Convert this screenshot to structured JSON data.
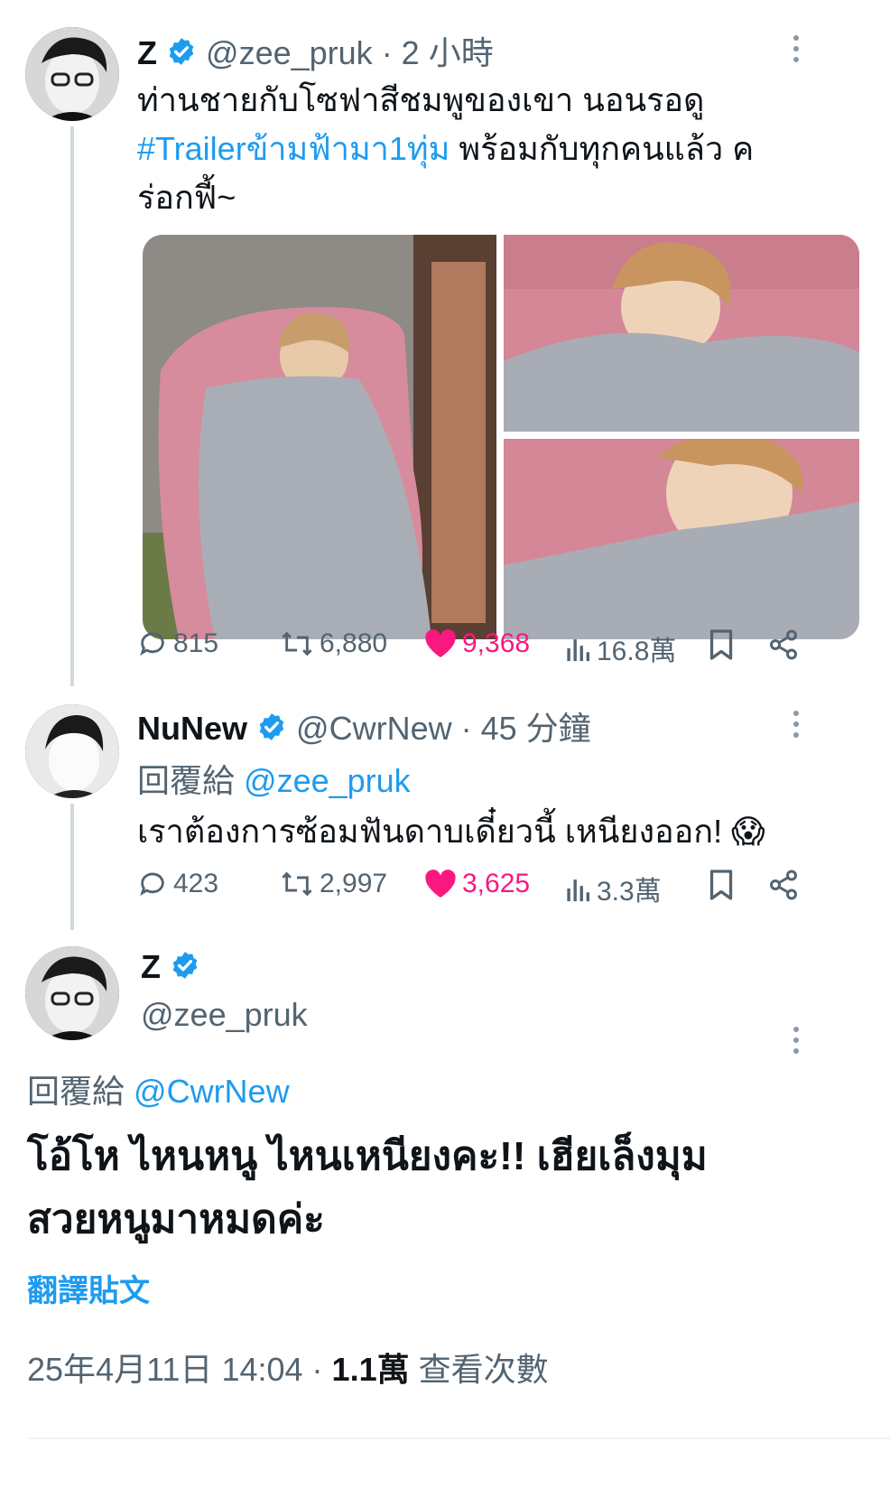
{
  "colors": {
    "accent": "#1d9bf0",
    "like": "#f91880",
    "muted": "#536471",
    "line": "#cfd9de",
    "sofa": "#d88f9f",
    "blanket": "#a8adb5"
  },
  "tweet1": {
    "name": "Z",
    "handle": "@zee_pruk",
    "time": "· 2 小時",
    "text_line1": "ท่านชายกับโซฟาสีชมพูของเขา นอนรอดู",
    "hashtag": "#Trailerข้ามฟ้ามา1ทุ่ม",
    "text_line2_rest": " พร้อมกับทุกคนแล้ว ค",
    "text_line3": "ร่อกฟี้~",
    "stats": {
      "replies": "815",
      "retweets": "6,880",
      "likes": "9,368",
      "views": "16.8萬"
    }
  },
  "tweet2": {
    "name": "NuNew",
    "handle": "@CwrNew",
    "time": "· 45 分鐘",
    "reply_prefix": "回覆給",
    "reply_to": "@zee_pruk",
    "text": "เราต้องการซ้อมฟันดาบเดี๋ยวนี้ เหนียงออก!",
    "emoji": "😱",
    "stats": {
      "replies": "423",
      "retweets": "2,997",
      "likes": "3,625",
      "views": "3.3萬"
    }
  },
  "tweet3": {
    "name": "Z",
    "handle": "@zee_pruk",
    "reply_prefix": "回覆給",
    "reply_to": "@CwrNew",
    "text_line1": "โอ้โห ไหนหนู ไหนเหนียงคะ!! เฮียเล็งมุม",
    "text_line2": "สวยหนูมาหมดค่ะ",
    "translate": "翻譯貼文",
    "timestamp": "25年4月11日 14:04 ·",
    "views_count": "1.1萬",
    "views_label": "查看次數"
  },
  "icons": [
    "more-icon",
    "verified-icon",
    "reply-icon",
    "retweet-icon",
    "like-icon",
    "views-icon",
    "bookmark-icon",
    "share-icon"
  ]
}
